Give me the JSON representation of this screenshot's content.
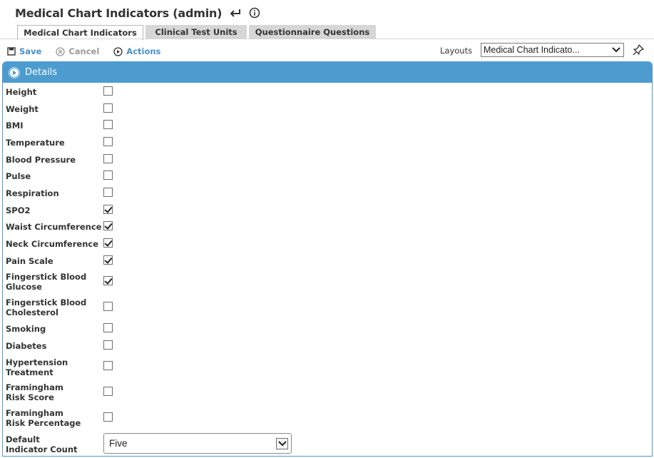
{
  "header": {
    "title": "Medical Chart Indicators (admin)",
    "back_icon": "return-icon",
    "info_icon": "info-icon"
  },
  "tabs": [
    {
      "label": "Medical Chart Indicators",
      "active": true
    },
    {
      "label": "Clinical Test Units",
      "active": false
    },
    {
      "label": "Questionnaire Questions",
      "active": false
    }
  ],
  "toolbar": {
    "save_label": "Save",
    "cancel_label": "Cancel",
    "actions_label": "Actions"
  },
  "layouts": {
    "label": "Layouts",
    "selected": "Medical Chart Indicato..."
  },
  "panel": {
    "title": "Details"
  },
  "fields": [
    {
      "label": "Height",
      "checked": false
    },
    {
      "label": "Weight",
      "checked": false
    },
    {
      "label": "BMI",
      "checked": false
    },
    {
      "label": "Temperature",
      "checked": false
    },
    {
      "label": "Blood Pressure",
      "checked": false
    },
    {
      "label": "Pulse",
      "checked": false
    },
    {
      "label": "Respiration",
      "checked": false
    },
    {
      "label": "SPO2",
      "checked": true
    },
    {
      "label": "Waist Circumference",
      "checked": true
    },
    {
      "label": "Neck Circumference",
      "checked": true
    },
    {
      "label": "Pain Scale",
      "checked": true
    },
    {
      "label": "Fingerstick Blood Glucose",
      "checked": true
    },
    {
      "label": "Fingerstick Blood Cholesterol",
      "checked": false
    },
    {
      "label": "Smoking",
      "checked": false
    },
    {
      "label": "Diabetes",
      "checked": false
    },
    {
      "label": "Hypertension Treatment",
      "checked": false
    },
    {
      "label": "Framingham Risk Score",
      "checked": false
    },
    {
      "label": "Framingham Risk Percentage",
      "checked": false
    }
  ],
  "default_count": {
    "label": "Default Indicator Count",
    "selected": "Five"
  },
  "colors": {
    "accent": "#4d9ccf",
    "link": "#4a90c8",
    "disabled": "#9a9a9a"
  }
}
